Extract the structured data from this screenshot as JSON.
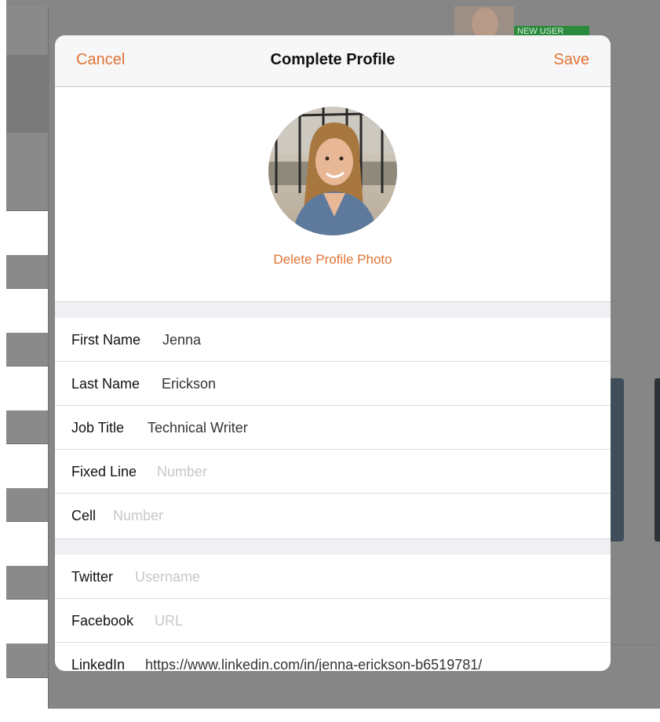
{
  "background": {
    "badge_text": "NEW USER"
  },
  "modal": {
    "cancel_label": "Cancel",
    "title": "Complete Profile",
    "save_label": "Save",
    "delete_photo_label": "Delete Profile Photo"
  },
  "fields": [
    {
      "label": "First Name",
      "value": "Jenna",
      "placeholder": ""
    },
    {
      "label": "Last Name",
      "value": "Erickson",
      "placeholder": ""
    },
    {
      "label": "Job Title",
      "value": "Technical Writer",
      "placeholder": ""
    },
    {
      "label": "Fixed Line",
      "value": "",
      "placeholder": "Number"
    },
    {
      "label": "Cell",
      "value": "",
      "placeholder": "Number"
    },
    {
      "label": "Twitter",
      "value": "",
      "placeholder": "Username"
    },
    {
      "label": "Facebook",
      "value": "",
      "placeholder": "URL"
    },
    {
      "label": "LinkedIn",
      "value": "https://www.linkedin.com/in/jenna-erickson-b6519781/",
      "placeholder": ""
    }
  ],
  "colors": {
    "accent": "#e07436",
    "placeholder": "#c7c7cc",
    "badge": "#2b8a3e"
  }
}
